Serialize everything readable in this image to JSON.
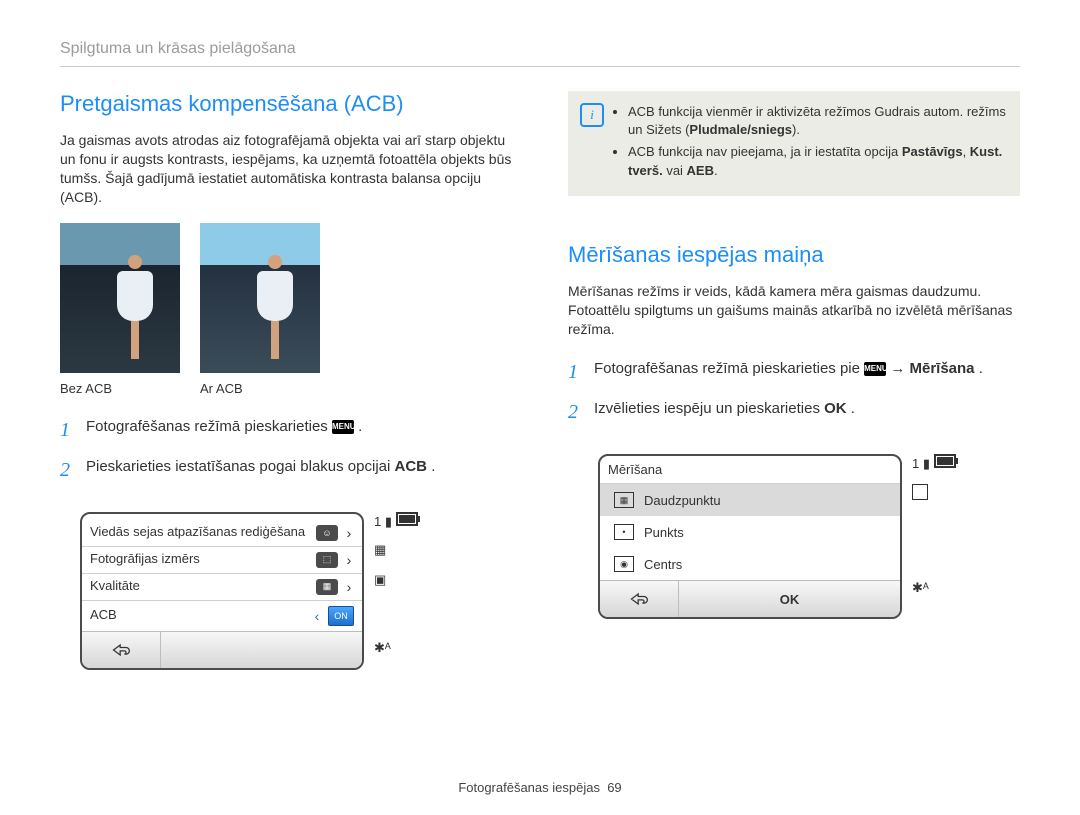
{
  "page_header": "Spilgtuma un krāsas pielāgošana",
  "left": {
    "title": "Pretgaismas kompensēšana (ACB)",
    "paragraph": "Ja gaismas avots atrodas aiz fotografējamā objekta vai arī starp objektu un fonu ir augsts kontrasts, iespējams, ka uzņemtā fotoattēla objekts būs tumšs. Šajā gadījumā iestatiet automātiska kontrasta balansa opciju (ACB).",
    "caption1": "Bez ACB",
    "caption2": "Ar ACB",
    "step1_pre": "Fotografēšanas režīmā pieskarieties ",
    "step1_post": ".",
    "step2_pre": "Pieskarieties iestatīšanas pogai blakus opcijai ",
    "step2_bold": "ACB",
    "step2_post": ".",
    "menu_icon": "MENU"
  },
  "right": {
    "note_bullets": [
      {
        "pre": "ACB funkcija vienmēr ir aktivizēta režīmos Gudrais autom. režīms un Sižets (",
        "bold": "Pludmale/sniegs",
        "post": ")."
      },
      {
        "pre": "ACB funkcija nav pieejama, ja ir iestatīta opcija ",
        "bold1": "Pastāvīgs",
        "mid": ", ",
        "bold2": "Kust. tverš.",
        "post2": " vai ",
        "bold3": "AEB",
        "end": "."
      }
    ],
    "title": "Mērīšanas iespējas maiņa",
    "paragraph": "Mērīšanas režīms ir veids, kādā kamera mēra gaismas daudzumu. Fotoattēlu spilgtums un gaišums mainās atkarībā no izvēlētā mērīšanas režīma.",
    "step1_pre": "Fotografēšanas režīmā pieskarieties pie ",
    "step1_arrow": " → ",
    "step1_bold": "Mērīšana",
    "step1_post": ".",
    "step2_pre": "Izvēlieties iespēju un pieskarieties ",
    "step2_ok": "OK",
    "step2_post": " ."
  },
  "settings_panel": {
    "rows": [
      {
        "label": "Viedās sejas atpazīšanas rediģēšana"
      },
      {
        "label": "Fotogrāfijas izmērs"
      },
      {
        "label": "Kvalitāte"
      },
      {
        "label": "ACB",
        "toggle": "ON"
      }
    ],
    "side_num": "1",
    "flash": "✱ᴬ"
  },
  "meter_panel": {
    "title": "Mērīšana",
    "options": [
      {
        "label": "Daudzpunktu",
        "selected": true,
        "icon": "grid"
      },
      {
        "label": "Punkts",
        "selected": false,
        "icon": "dot"
      },
      {
        "label": "Centrs",
        "selected": false,
        "icon": "center"
      }
    ],
    "ok": "OK",
    "side_num": "1",
    "flash": "✱ᴬ"
  },
  "footer": {
    "label": "Fotografēšanas iespējas",
    "page": "69"
  }
}
